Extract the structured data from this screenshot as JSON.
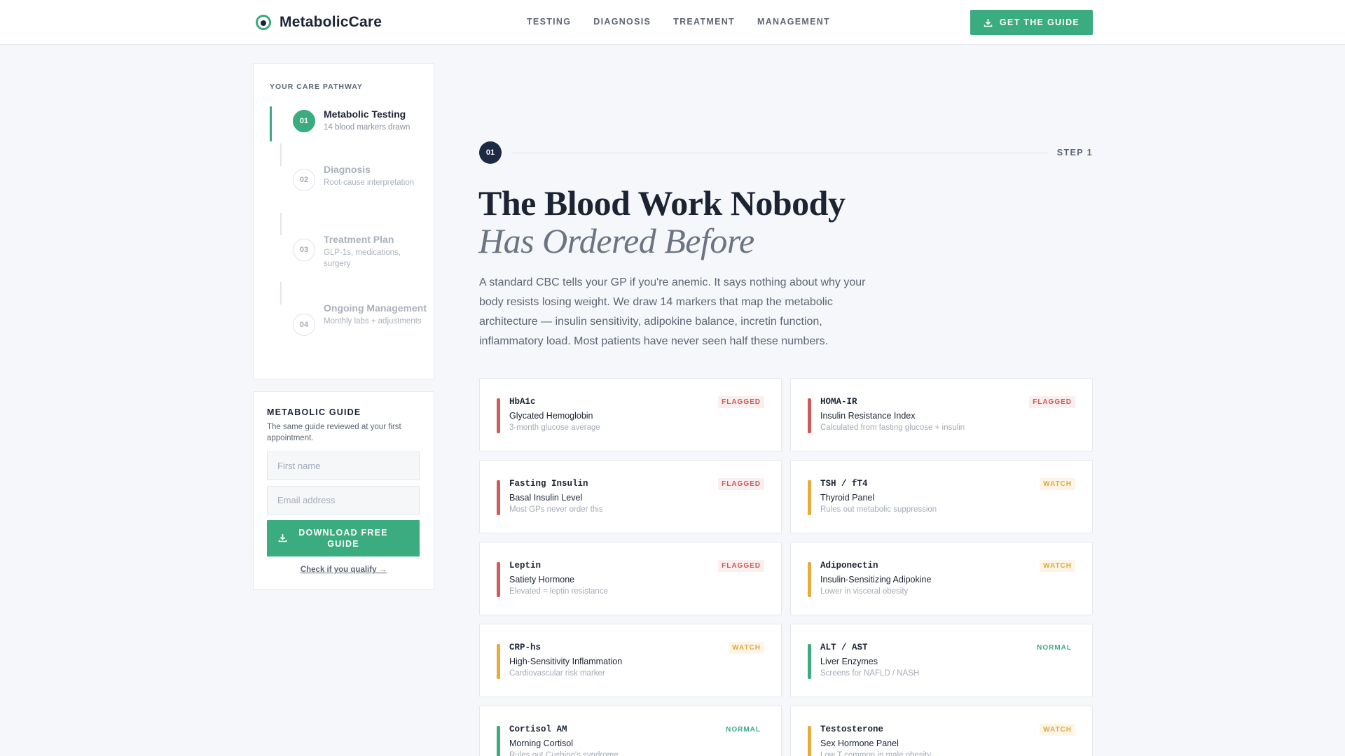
{
  "header": {
    "brand": "MetabolicCare",
    "nav": [
      "TESTING",
      "DIAGNOSIS",
      "TREATMENT",
      "MANAGEMENT"
    ],
    "cta": "GET THE GUIDE"
  },
  "pathway": {
    "title": "YOUR CARE PATHWAY",
    "steps": [
      {
        "num": "01",
        "title": "Metabolic Testing",
        "sub": "14 blood markers drawn",
        "active": true
      },
      {
        "num": "02",
        "title": "Diagnosis",
        "sub": "Root-cause interpretation",
        "active": false
      },
      {
        "num": "03",
        "title": "Treatment Plan",
        "sub": "GLP-1s, medications, surgery",
        "active": false
      },
      {
        "num": "04",
        "title": "Ongoing Management",
        "sub": "Monthly labs + adjustments",
        "active": false
      }
    ]
  },
  "guide": {
    "title": "METABOLIC GUIDE",
    "desc": "The same guide reviewed at your first appointment.",
    "first_name_placeholder": "First name",
    "email_placeholder": "Email address",
    "button": "DOWNLOAD FREE GUIDE",
    "link": "Check if you qualify →"
  },
  "main": {
    "step_num": "01",
    "step_label": "STEP 1",
    "headline": "The Blood Work Nobody",
    "headline_italic": "Has Ordered Before",
    "intro": "A standard CBC tells your GP if you're anemic. It says nothing about why your body resists losing weight. We draw 14 markers that map the metabolic architecture — insulin sensitivity, adipokine balance, incretin function, inflammatory load. Most patients have never seen half these numbers."
  },
  "markers": [
    {
      "code": "HbA1c",
      "name": "Glycated Hemoglobin",
      "note": "3-month glucose average",
      "status": "FLAGGED",
      "level": "flagged"
    },
    {
      "code": "HOMA-IR",
      "name": "Insulin Resistance Index",
      "note": "Calculated from fasting glucose + insulin",
      "status": "FLAGGED",
      "level": "flagged"
    },
    {
      "code": "Fasting Insulin",
      "name": "Basal Insulin Level",
      "note": "Most GPs never order this",
      "status": "FLAGGED",
      "level": "flagged"
    },
    {
      "code": "TSH / fT4",
      "name": "Thyroid Panel",
      "note": "Rules out metabolic suppression",
      "status": "WATCH",
      "level": "watch"
    },
    {
      "code": "Leptin",
      "name": "Satiety Hormone",
      "note": "Elevated = leptin resistance",
      "status": "FLAGGED",
      "level": "flagged"
    },
    {
      "code": "Adiponectin",
      "name": "Insulin-Sensitizing Adipokine",
      "note": "Lower in visceral obesity",
      "status": "WATCH",
      "level": "watch"
    },
    {
      "code": "CRP-hs",
      "name": "High-Sensitivity Inflammation",
      "note": "Cardiovascular risk marker",
      "status": "WATCH",
      "level": "watch"
    },
    {
      "code": "ALT / AST",
      "name": "Liver Enzymes",
      "note": "Screens for NAFLD / NASH",
      "status": "NORMAL",
      "level": "normal"
    },
    {
      "code": "Cortisol AM",
      "name": "Morning Cortisol",
      "note": "Rules out Cushing's syndrome",
      "status": "NORMAL",
      "level": "normal"
    },
    {
      "code": "Testosterone",
      "name": "Sex Hormone Panel",
      "note": "Low T common in male obesity",
      "status": "WATCH",
      "level": "watch"
    }
  ]
}
